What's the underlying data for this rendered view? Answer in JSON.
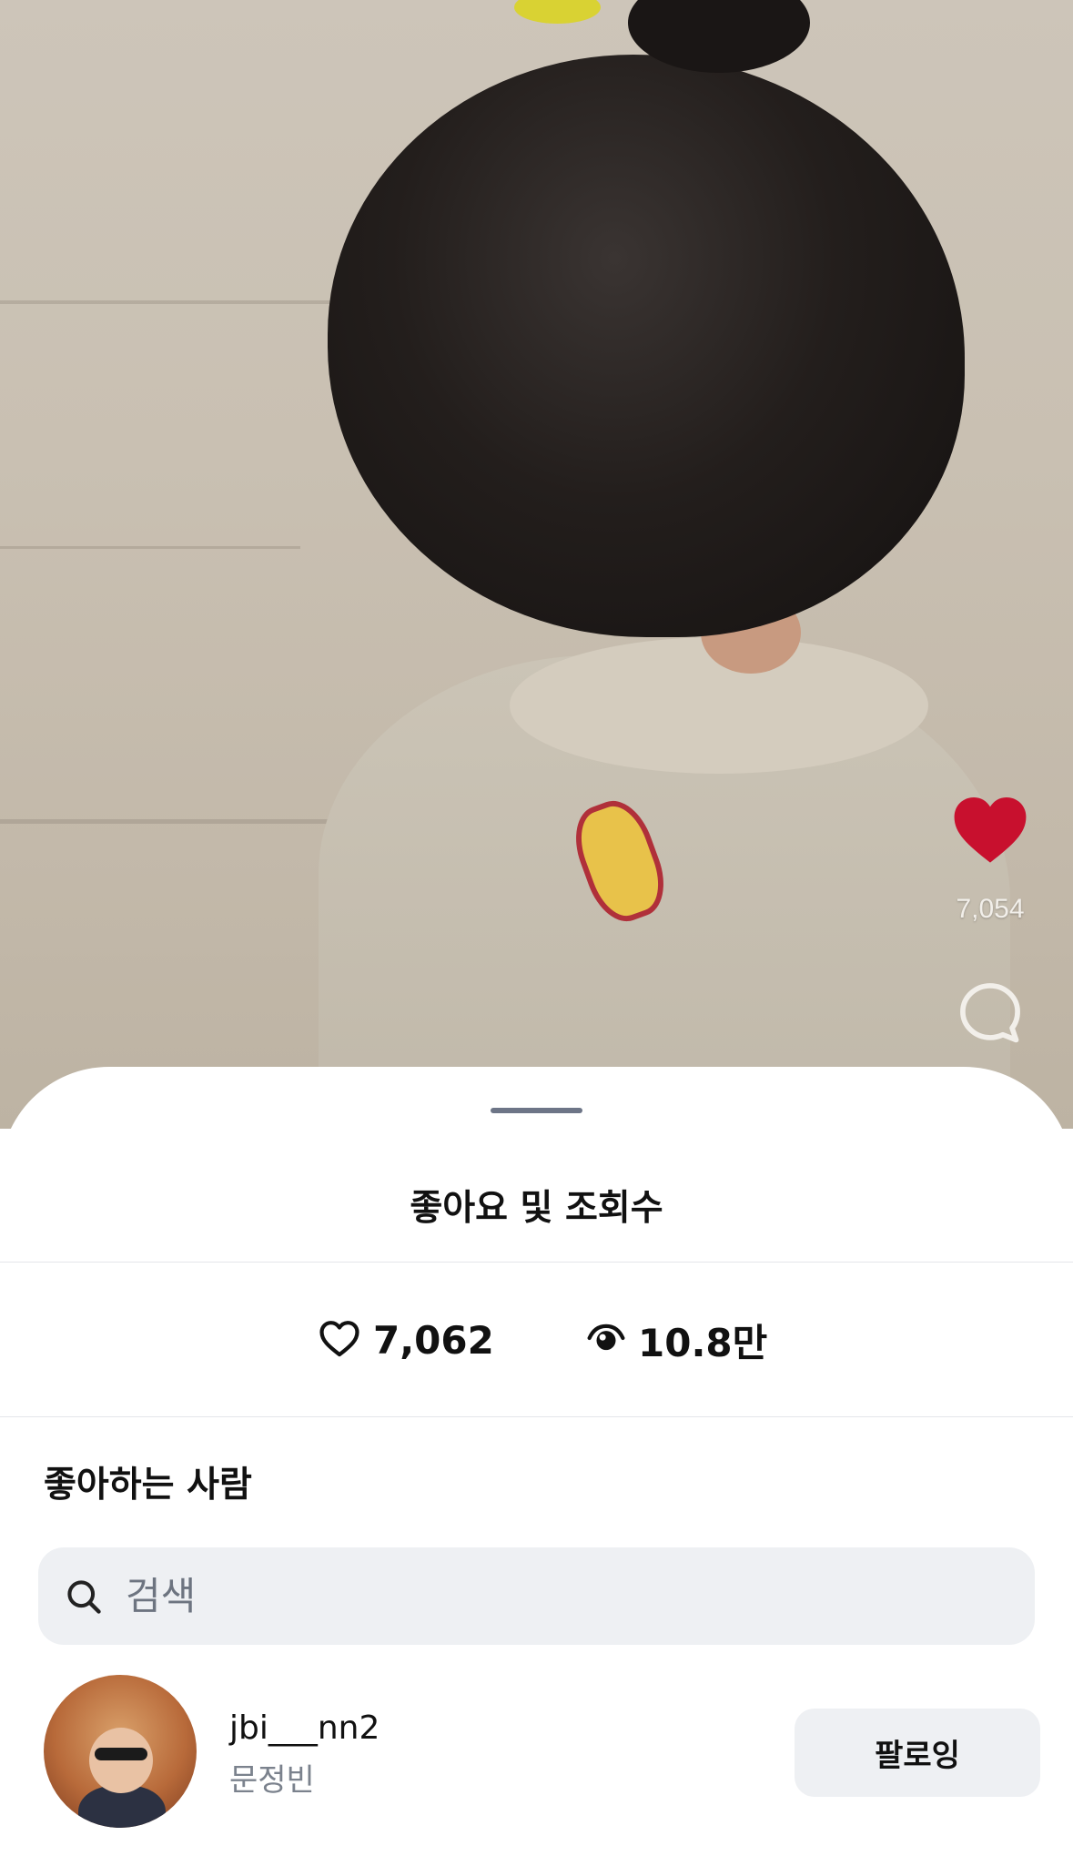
{
  "video": {
    "side_like_count": "7,054",
    "like_icon": "heart-filled-icon",
    "comment_icon": "comment-bubble-icon",
    "like_color": "#c8102e"
  },
  "sheet": {
    "title": "좋아요 및 조회수",
    "stats": {
      "likes_icon": "heart-outline-icon",
      "likes": "7,062",
      "views_icon": "eye-icon",
      "views": "10.8만"
    },
    "likers_section_title": "좋아하는 사람",
    "search": {
      "icon": "search-icon",
      "placeholder": "검색",
      "value": ""
    },
    "users": [
      {
        "username": "jbi___nn2",
        "display_name": "문정빈",
        "button_label": "팔로잉"
      }
    ]
  }
}
